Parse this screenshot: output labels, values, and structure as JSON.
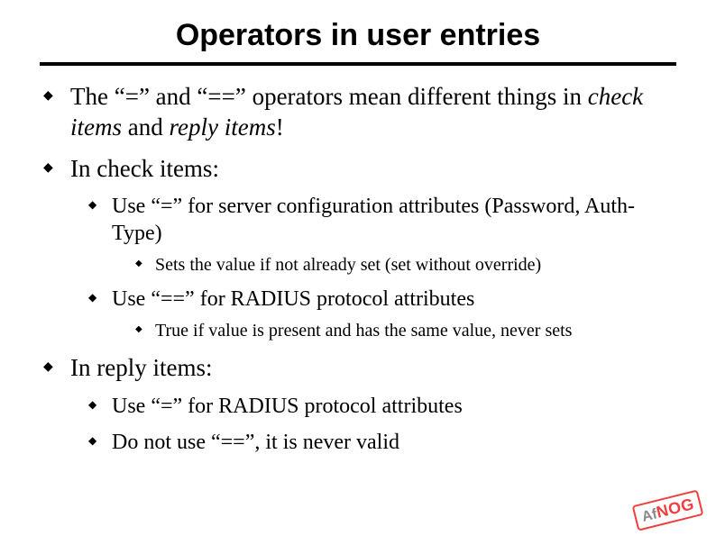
{
  "title": "Operators in user entries",
  "bullets": {
    "b1_pre": "The “=” and “==” operators mean different things in ",
    "b1_it1": "check items",
    "b1_mid": " and ",
    "b1_it2": "reply items",
    "b1_post": "!",
    "b2": "In check items:",
    "b2_1": "Use “=” for server configuration attributes (Password, Auth-Type)",
    "b2_1_1": "Sets the value if not already set (set without override)",
    "b2_2": "Use “==” for RADIUS protocol attributes",
    "b2_2_1": "True if value is present and has the same value, never sets",
    "b3": "In reply items:",
    "b3_1": "Use “=” for RADIUS protocol attributes",
    "b3_2": "Do not use “==”, it is never valid"
  },
  "logo": {
    "af": "Af",
    "nog": "NOG"
  }
}
